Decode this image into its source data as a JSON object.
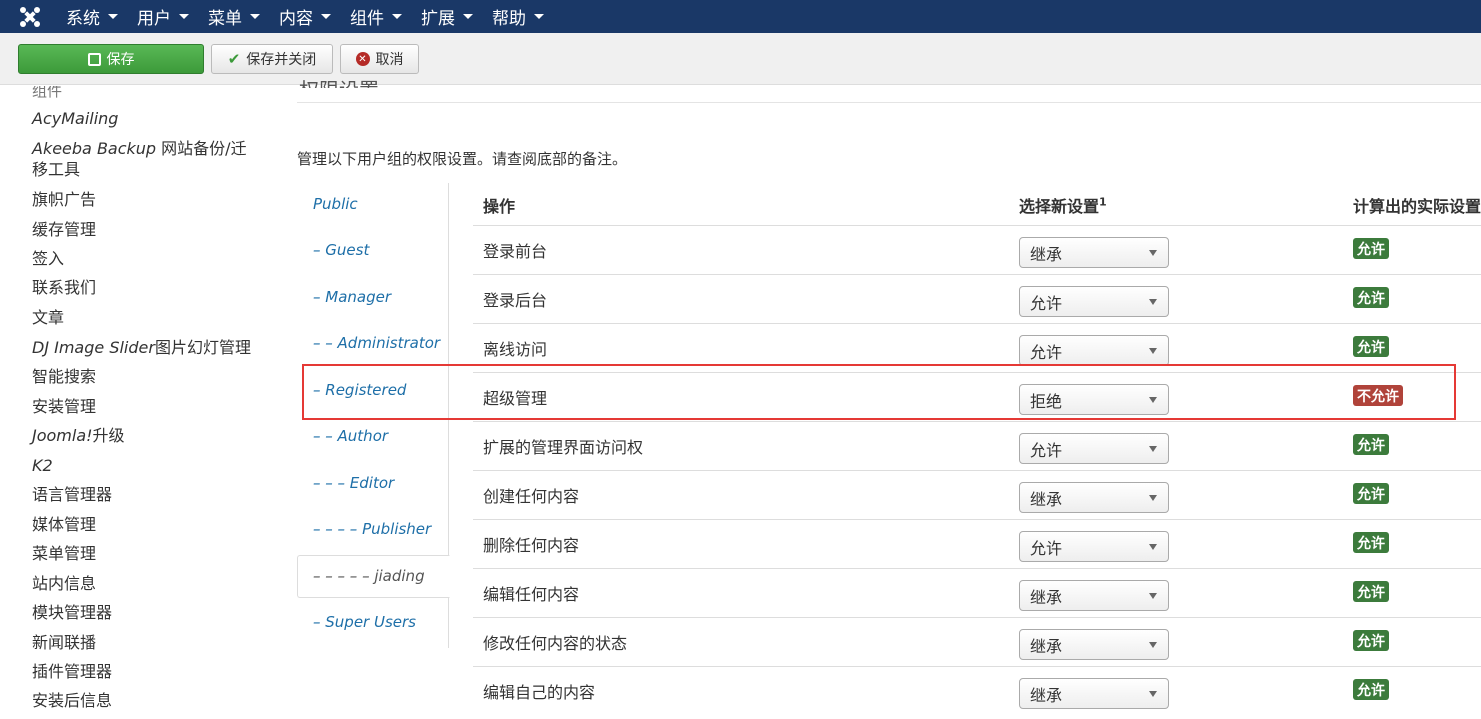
{
  "topnav": {
    "menus": [
      "系统",
      "用户",
      "菜单",
      "内容",
      "组件",
      "扩展",
      "帮助"
    ]
  },
  "toolbar": {
    "save_label": "保存",
    "save_close_label": "保存并关闭",
    "cancel_label": "取消"
  },
  "sidebar": {
    "header": "组件",
    "items": [
      "AcyMailing",
      "Akeeba Backup 网站备份/迁移工具",
      "旗帜广告",
      "缓存管理",
      "签入",
      "联系我们",
      "文章",
      "DJ Image Slider图片幻灯管理",
      "智能搜索",
      "安装管理",
      "Joomla!升级",
      "K2",
      "语言管理器",
      "媒体管理",
      "菜单管理",
      "站内信息",
      "模块管理器",
      "新闻联播",
      "插件管理器",
      "安装后信息"
    ]
  },
  "main": {
    "title": "权限设置",
    "description": "管理以下用户组的权限设置。请查阅底部的备注。"
  },
  "groups": [
    "Public",
    "– Guest",
    "– Manager",
    "– – Administrator",
    "– Registered",
    "– – Author",
    "– – – Editor",
    "– – – – Publisher",
    "– – – – – jiading",
    "– Super Users"
  ],
  "table": {
    "headers": {
      "action": "操作",
      "select": "选择新设置",
      "select_sup": "1",
      "calc": "计算出的实际设置"
    },
    "rows": [
      {
        "action": "登录前台",
        "select": "继承",
        "calc": "允许"
      },
      {
        "action": "登录后台",
        "select": "允许",
        "calc": "允许"
      },
      {
        "action": "离线访问",
        "select": "允许",
        "calc": "允许"
      },
      {
        "action": "超级管理",
        "select": "拒绝",
        "calc": "不允许"
      },
      {
        "action": "扩展的管理界面访问权",
        "select": "允许",
        "calc": "允许"
      },
      {
        "action": "创建任何内容",
        "select": "继承",
        "calc": "允许"
      },
      {
        "action": "删除任何内容",
        "select": "允许",
        "calc": "允许"
      },
      {
        "action": "编辑任何内容",
        "select": "继承",
        "calc": "允许"
      },
      {
        "action": "修改任何内容的状态",
        "select": "继承",
        "calc": "允许"
      },
      {
        "action": "编辑自己的内容",
        "select": "继承",
        "calc": "允许"
      }
    ]
  },
  "colors": {
    "allowed": "#3c7b3c",
    "denied": "#b0433a",
    "nav": "#1a3867",
    "link": "#1e6fa8"
  }
}
